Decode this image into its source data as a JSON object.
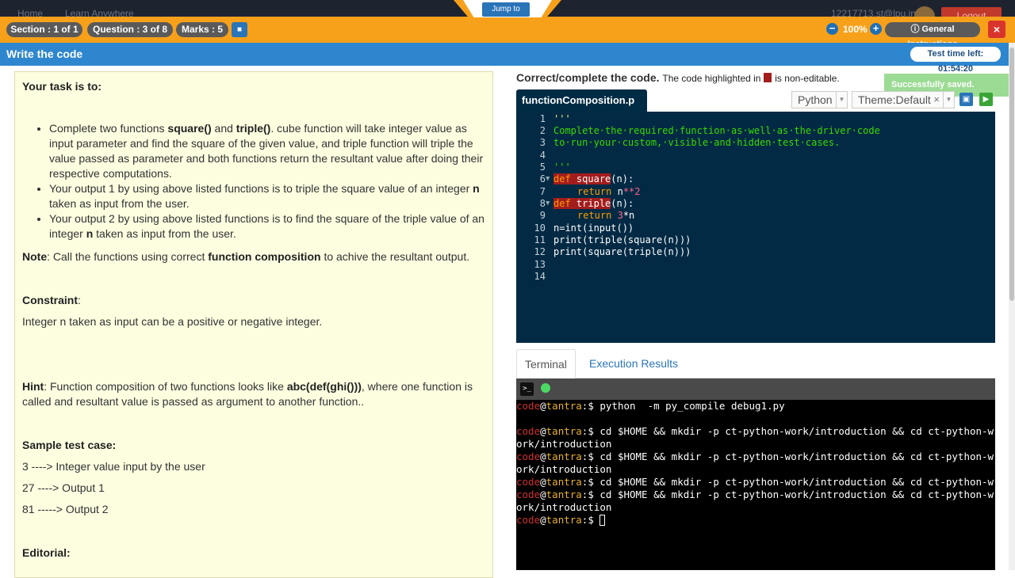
{
  "top": {
    "nav": [
      "Home",
      "Learn Anywhere"
    ],
    "user": "12217713.st@lpu.in",
    "logout": "Logout"
  },
  "jump": "Jump to",
  "header": {
    "section": "Section : 1 of 1",
    "question": "Question : 3 of 8",
    "marks": "Marks : 5",
    "zoom": "100%",
    "zoom_out": "−",
    "zoom_in": "+",
    "general_instructions": "General Instructions",
    "close": "×"
  },
  "titlebar": {
    "title": "Write the code",
    "timer": "Test time left: 01:54:20"
  },
  "question": {
    "task_heading": "Your task is to:",
    "bullets": [
      {
        "a": "Complete two functions ",
        "b1": "square()",
        "c": " and ",
        "b2": "triple()",
        "d": ". cube function will take integer value as input parameter and find the square of the given value, and triple function will triple the value passed as parameter and both functions return the resultant value after doing their respective computations."
      },
      {
        "a": "Your output 1 by using above listed functions is to triple the square value of an integer ",
        "b1": "n",
        "d": " taken as input from the user."
      },
      {
        "a": "Your output 2 by using above listed functions is to find the square of the triple value of an integer ",
        "b1": "n",
        "d": " taken as input from the user."
      }
    ],
    "note_label": "Note",
    "note_a": ": Call the functions using correct ",
    "note_b": "function composition",
    "note_c": " to achive the resultant output.",
    "constraint_label": "Constraint",
    "constraint_colon": ":",
    "constraint_text": "Integer n taken as input can be a positive or negative integer.",
    "hint_label": "Hint",
    "hint_a": ": Function composition of two functions looks like ",
    "hint_b": "abc(def(ghi()))",
    "hint_c": ", where one function is called and resultant value is passed as argument to another function..",
    "sample_heading": "Sample test case:",
    "sample_lines": [
      "3 ----> Integer value input by the user",
      "27 ----> Output 1",
      "81 -----> Output 2"
    ],
    "editorial": "Editorial:"
  },
  "editor_header": {
    "title": "Correct/complete the code.",
    "note_a": "The code highlighted in",
    "note_b": "is non-editable.",
    "toast": "Successfully saved.",
    "filename": "functionComposition.p",
    "language": "Python",
    "theme": "Theme:Default",
    "theme_clear": "×"
  },
  "code": {
    "line_numbers": [
      "1",
      "2",
      "3",
      "4",
      "5",
      "6",
      "7",
      "8",
      "9",
      "10",
      "11",
      "12",
      "13",
      "14"
    ],
    "l1": "'''",
    "l2": "Complete·the·required·function·as·well·as·the·driver·code",
    "l3": "to·run·your·custom,·visible·and·hidden·test·cases.",
    "l5": "'''",
    "l6_kw": "def",
    "l6_name": "square",
    "l6_rest": "(n):",
    "l7_kw": "return",
    "l7_a": "n",
    "l7_num": "**2",
    "l8_kw": "def",
    "l8_name": "triple",
    "l8_rest": "(n):",
    "l9_kw": "return",
    "l9_num": "3",
    "l9_rest": "*n",
    "l10": "n=int(input())",
    "l11": "print(triple(square(n)))",
    "l12": "print(square(triple(n)))"
  },
  "tabs": {
    "terminal": "Terminal",
    "results": "Execution Results"
  },
  "terminal": {
    "user": "code",
    "at": "@",
    "host": "tantra",
    "prompt": ":$ ",
    "cmd1": "python  -m py_compile debug1.py",
    "cmd2a": "cd $HOME && mkdir -p ct-python-work/introduction && cd ct-python-w",
    "cmd2b": "ork/introduction"
  }
}
